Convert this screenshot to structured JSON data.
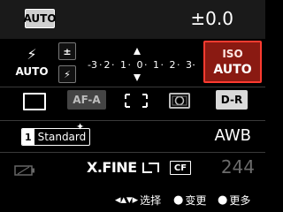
{
  "top": {
    "mode_label": "AUTO",
    "exposure_comp": "±0.0"
  },
  "flash": {
    "icon": "flash-icon",
    "label": "AUTO"
  },
  "ev": {
    "icons": [
      "exposure-comp-icon",
      "flash-comp-icon"
    ],
    "icon_glyphs": [
      "±",
      "⚡"
    ],
    "scale_labels": [
      "-3",
      "2",
      "1",
      "0",
      "1",
      "2",
      "3+"
    ],
    "indicator_value": 0
  },
  "iso": {
    "label": "ISO",
    "value": "AUTO",
    "border_color": "#ff3b30",
    "fill_color": "#8a1a12"
  },
  "settings": {
    "drive_mode_icon": "single-shot-icon",
    "af_mode": "AF-A",
    "focus_area_icon": "wide-focus-area-icon",
    "metering_icon": "multi-metering-icon",
    "dro": "D-R"
  },
  "style": {
    "number": "1",
    "name": "Standard",
    "star_icon": "sparkle-icon",
    "white_balance": "AWB"
  },
  "info": {
    "battery_icon": "battery-empty-icon",
    "quality": "X.FINE",
    "aspect_icon": "aspect-ratio-icon",
    "card_label": "CF",
    "shots_remaining": "244"
  },
  "footer": {
    "select_glyph": "◂▴▾▸",
    "select_label": "选择",
    "change_glyph": "●",
    "change_label": "变更",
    "more_glyph": "●",
    "more_label": "更多"
  }
}
